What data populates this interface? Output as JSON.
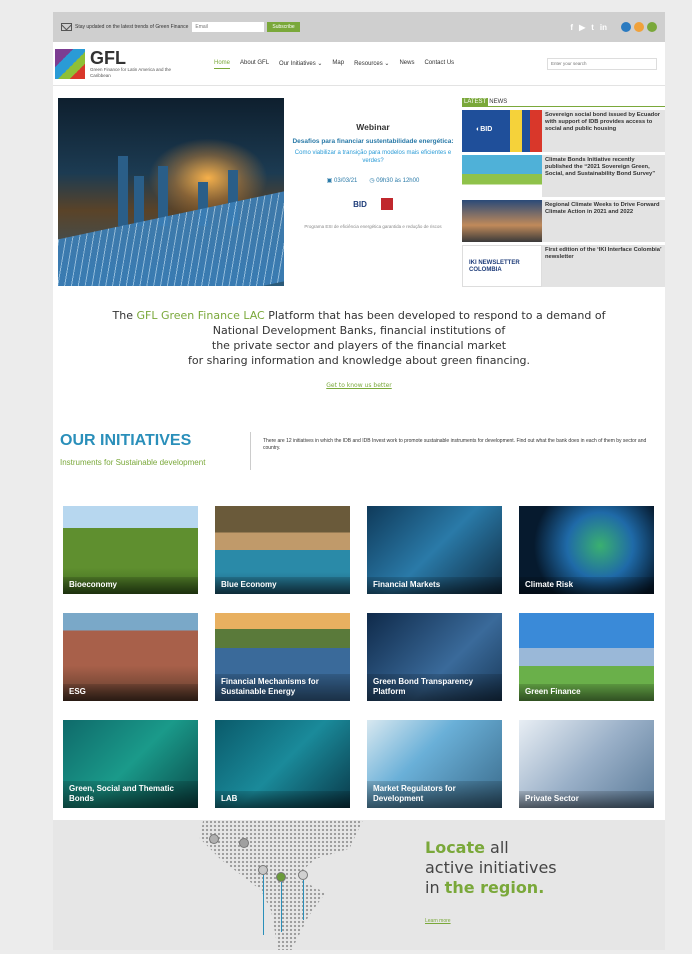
{
  "topbar": {
    "newsletter_text": "Stay updated on the latest trends of Green Finance",
    "email_placeholder": "Email",
    "subscribe_label": "Subscribe",
    "social_icons": [
      "facebook-icon",
      "youtube-icon",
      "twitter-icon",
      "linkedin-icon"
    ],
    "circle_colors": [
      "#2a7ac0",
      "#f0a13a",
      "#7aa83a"
    ]
  },
  "header": {
    "logo_title": "GFL",
    "logo_subtitle": "Green Finance for Latin America and the Caribbean",
    "nav": [
      {
        "label": "Home",
        "active": true
      },
      {
        "label": "About GFL"
      },
      {
        "label": "Our Initiatives ⌄"
      },
      {
        "label": "Map"
      },
      {
        "label": "Resources ⌄"
      },
      {
        "label": "News"
      },
      {
        "label": "Contact Us"
      }
    ],
    "search_placeholder": "Enter your search"
  },
  "webinar": {
    "title": "Webinar",
    "subtitle": "Desafios para financiar sustentabilidade energética:",
    "question": "Como viabilizar a transição para modelos mais eficientes e verdes?",
    "date": "03/03/21",
    "time": "09h30 às 12h00",
    "logo_label": "BID",
    "program": "Programa ESI de eficiência energética garantida e redução de riscos"
  },
  "news": {
    "latest_label": "LATEST",
    "news_label": "NEWS",
    "items": [
      {
        "title": "Sovereign social bond issued by Ecuador with support of IDB provides access to social and public housing"
      },
      {
        "title": "Climate Bonds Initiative recently published the “2021 Sovereign Green, Social, and Sustainability Bond Survey”"
      },
      {
        "title": "Regional Climate Weeks to Drive Forward Climate Action in 2021 and 2022"
      },
      {
        "title": "First edition of the ‘IKI Interface Colombia’ newsletter",
        "thumb_label": "IKI NEWSLETTER COLOMBIA"
      }
    ]
  },
  "intro": {
    "prefix": "The ",
    "highlight": "GFL Green Finance LAC",
    "line1_rest": " Platform that has been developed to respond to a demand of",
    "line2": "National Development Banks, financial institutions of",
    "line3": "the private sector and players of the financial market",
    "line4": "for sharing information and knowledge about green financing.",
    "link": "Get to know us better"
  },
  "initiatives": {
    "title": "OUR INITIATIVES",
    "subtitle": "Instruments for Sustainable development",
    "description": "There are 12 initiatives in which the IDB and IDB Invest work to promote sustainable instruments for development. Find out what the bank does in each of them by sector and country.",
    "tiles": [
      {
        "label": "Bioeconomy"
      },
      {
        "label": "Blue Economy"
      },
      {
        "label": "Financial Markets"
      },
      {
        "label": "Climate Risk"
      },
      {
        "label": "ESG"
      },
      {
        "label": "Financial Mechanisms for Sustainable Energy"
      },
      {
        "label": "Green Bond Transparency Platform"
      },
      {
        "label": "Green Finance"
      },
      {
        "label": "Green, Social and Thematic Bonds"
      },
      {
        "label": "LAB"
      },
      {
        "label": "Market Regulators for Development"
      },
      {
        "label": "Private Sector"
      }
    ]
  },
  "map_section": {
    "locate": "Locate",
    "all": " all",
    "line2": "active initiatives",
    "in": "in ",
    "region": "the region.",
    "link": "Learn more"
  }
}
